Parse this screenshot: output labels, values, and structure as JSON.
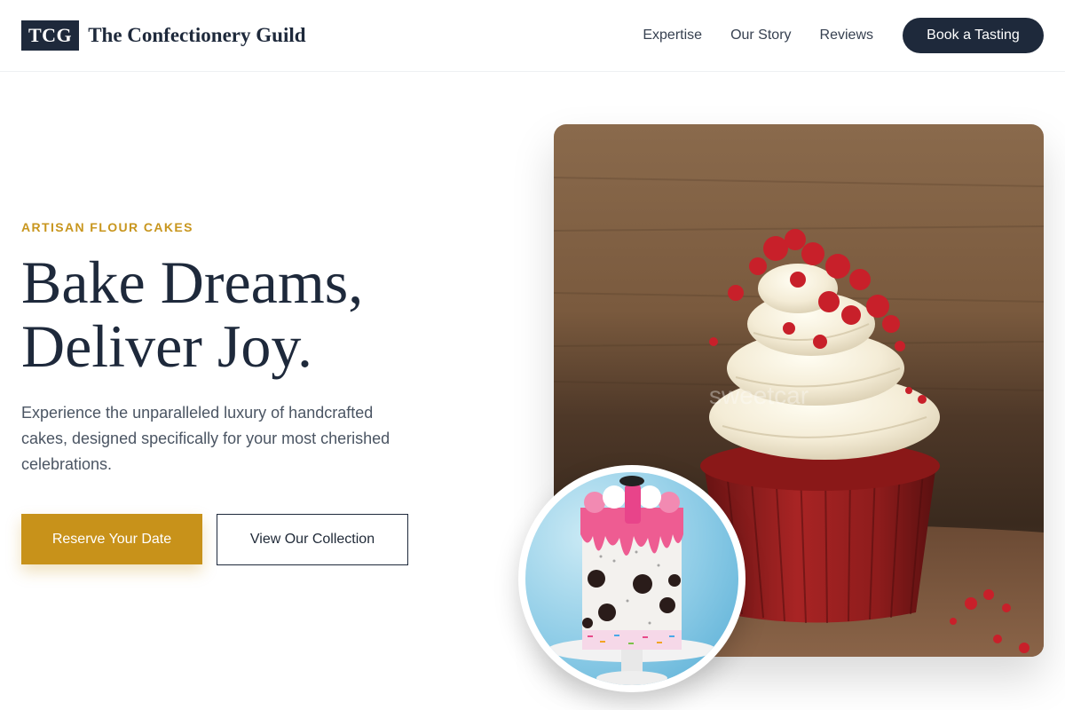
{
  "brand": {
    "logo_mark": "TCG",
    "name": "The Confectionery Guild"
  },
  "nav": {
    "links": [
      "Expertise",
      "Our Story",
      "Reviews"
    ],
    "cta_label": "Book a Tasting"
  },
  "hero": {
    "eyebrow": "ARTISAN FLOUR CAKES",
    "headline_line1": "Bake Dreams,",
    "headline_line2": "Deliver Joy.",
    "description": "Experience the unparalleled luxury of handcrafted cakes, designed specifically for your most cherished celebrations.",
    "primary_button": "Reserve Your Date",
    "secondary_button": "View Our Collection"
  },
  "images": {
    "main_image": "red-velvet-cupcake-photo",
    "main_watermark": "sweetcar",
    "secondary_image": "drip-cake-with-cookies-photo"
  },
  "colors": {
    "navy": "#1e293b",
    "gold": "#c8921a",
    "eyebrow_gold": "#c8961e"
  }
}
